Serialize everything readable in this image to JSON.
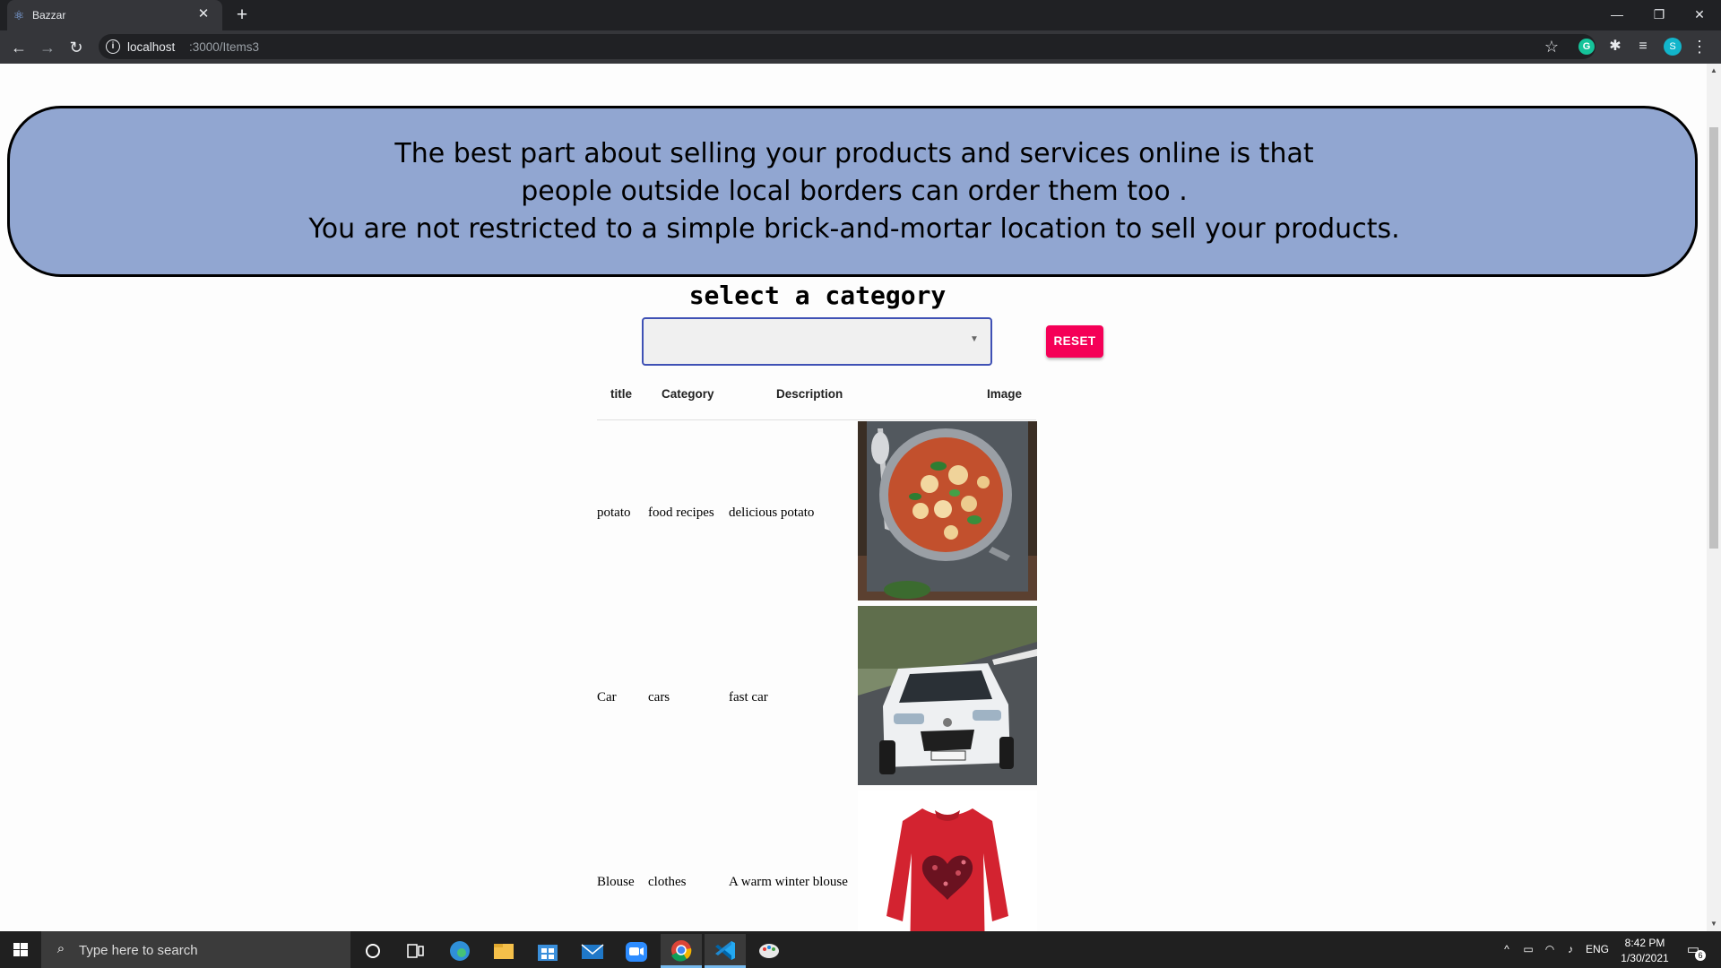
{
  "browser": {
    "tab_title": "Bazzar",
    "tab_icon": "react-icon",
    "tab_close": "✕",
    "new_tab": "+",
    "url_host": "localhost",
    "url_path": ":3000/Items3",
    "profile_initial": "S",
    "extension_letter": "G",
    "window_controls": {
      "minimize": "—",
      "restore": "❐",
      "close": "✕"
    }
  },
  "banner": {
    "lines": [
      "The best part about selling your products and services online is that",
      "people outside local borders can order them too .",
      "You are not restricted to a simple brick-and-mortar location to sell your products."
    ],
    "background": "#91a6d1"
  },
  "filter": {
    "heading": "select a category",
    "selected_value": "",
    "reset_label": "RESET",
    "reset_color": "#f50057",
    "focus_color": "#3f51b5"
  },
  "table": {
    "columns": [
      "title",
      "Category",
      "Description",
      "Image"
    ],
    "rows": [
      {
        "title": "potato",
        "category": "food recipes",
        "description": "delicious potato",
        "image": "gnocchi dish in pan"
      },
      {
        "title": "Car",
        "category": "cars",
        "description": "fast car",
        "image": "white car"
      },
      {
        "title": "Blouse",
        "category": "clothes",
        "description": "A warm winter blouse",
        "image": "red sweater with heart"
      }
    ]
  },
  "taskbar": {
    "search_placeholder": "Type here to search",
    "apps": [
      "cortana-icon",
      "task-view-icon",
      "edge-icon",
      "file-explorer-icon",
      "store-icon",
      "mail-icon",
      "zoom-icon",
      "chrome-icon",
      "vscode-icon",
      "paint-icon"
    ],
    "language": "ENG",
    "time": "8:42 PM",
    "date": "1/30/2021",
    "notification_count": "6"
  }
}
